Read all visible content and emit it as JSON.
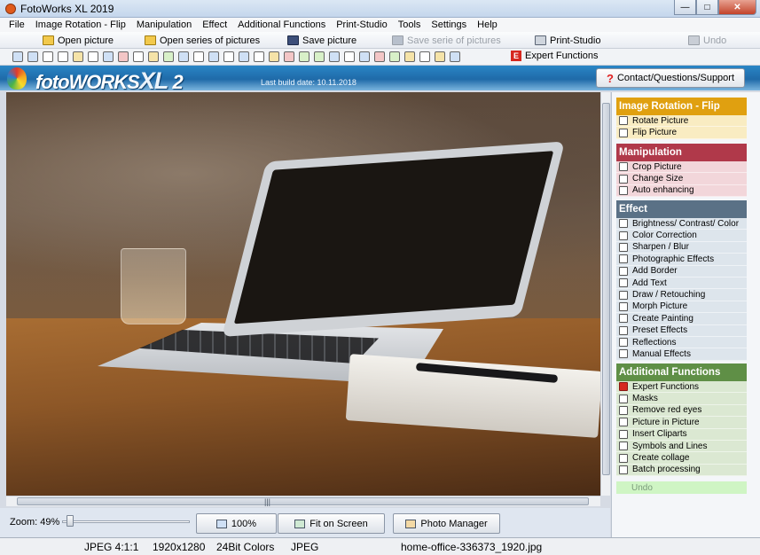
{
  "window": {
    "title": "FotoWorks XL 2019"
  },
  "menu": [
    "File",
    "Image Rotation - Flip",
    "Manipulation",
    "Effect",
    "Additional Functions",
    "Print-Studio",
    "Tools",
    "Settings",
    "Help"
  ],
  "toolbar": {
    "open_picture": "Open picture",
    "open_series": "Open series of pictures",
    "save_picture": "Save picture",
    "save_series": "Save serie of pictures",
    "print_studio": "Print-Studio",
    "undo": "Undo",
    "expert_functions": "Expert Functions",
    "expert_icon_letter": "E"
  },
  "banner": {
    "logo_main": "fotoWORKS",
    "logo_xl": "XL",
    "logo_version": "2",
    "build": "Last build date: 10.11.2018"
  },
  "contact_button": "Contact/Questions/Support",
  "sidebar": {
    "sections": [
      {
        "title": "Image Rotation - Flip",
        "color": "#e0a010",
        "item_bg": "#f9ecc2",
        "items": [
          "Rotate Picture",
          "Flip Picture"
        ]
      },
      {
        "title": "Manipulation",
        "color": "#b0394a",
        "item_bg": "#f2d6da",
        "items": [
          "Crop Picture",
          "Change Size",
          "Auto enhancing"
        ]
      },
      {
        "title": "Effect",
        "color": "#5a7186",
        "item_bg": "#dde5ec",
        "items": [
          "Brightness/ Contrast/ Color",
          "Color Correction",
          "Sharpen / Blur",
          "Photographic Effects",
          "Add Border",
          "Add Text",
          "Draw / Retouching",
          "Morph Picture",
          "Create Painting",
          "Preset Effects",
          "Reflections",
          "Manual Effects"
        ]
      },
      {
        "title": "Additional Functions",
        "color": "#5f8f46",
        "item_bg": "#dbe8d2",
        "items": [
          "Expert Functions",
          "Masks",
          "Remove red eyes",
          "Picture in Picture",
          "Insert Cliparts",
          "Symbols and Lines",
          "Create collage",
          "Batch processing"
        ]
      }
    ],
    "undo": "Undo"
  },
  "zoom": {
    "label": "Zoom: 49%",
    "level_fraction": 0.05
  },
  "buttons": {
    "zoom100": "100%",
    "fit": "Fit on Screen",
    "photo_manager": "Photo Manager"
  },
  "status": {
    "format": "JPEG 4:1:1",
    "resolution": "1920x1280",
    "colors": "24Bit Colors",
    "type": "JPEG",
    "filename": "home-office-336373_1920.jpg"
  }
}
